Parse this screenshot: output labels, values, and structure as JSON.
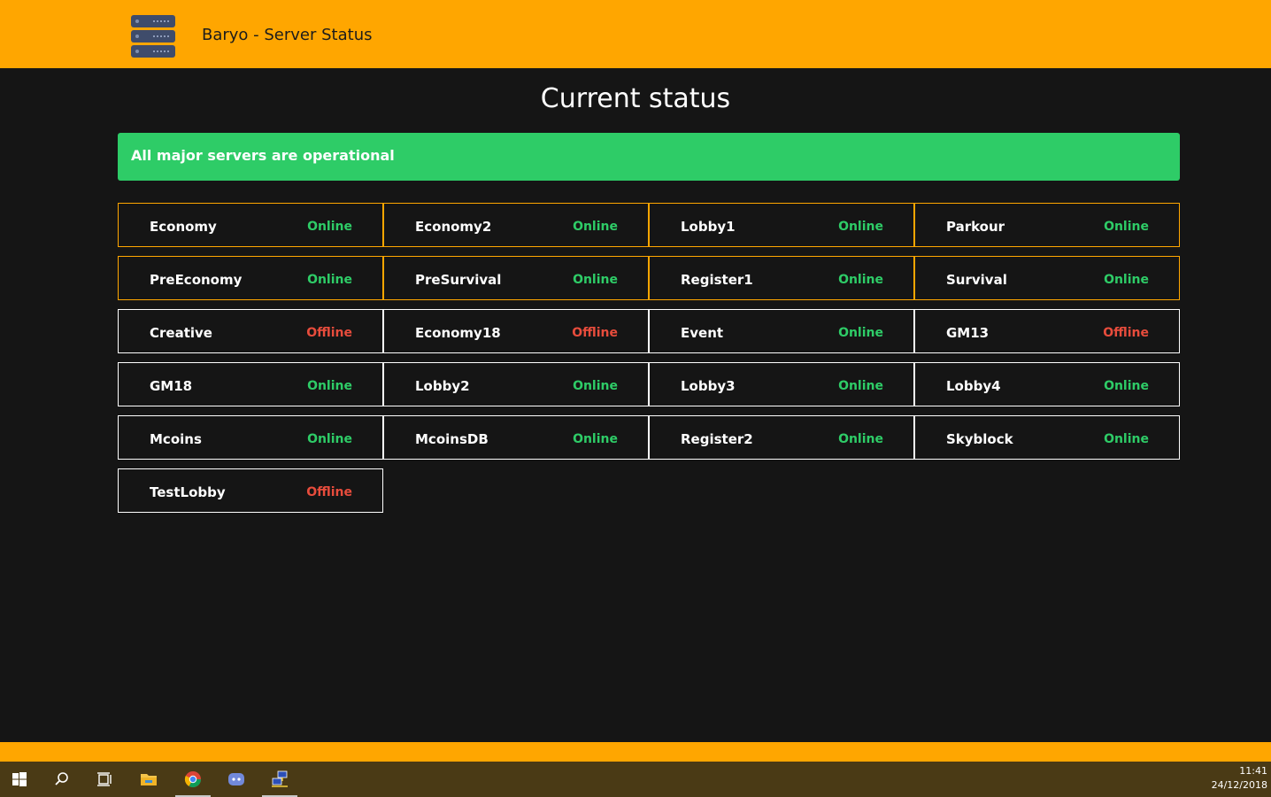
{
  "header": {
    "title": "Baryo - Server Status",
    "logo_icon": "server-rack-icon"
  },
  "page_title": "Current status",
  "alert": {
    "text": "All major servers are operational",
    "color": "#2ecc67"
  },
  "colors": {
    "accent": "#ffa600",
    "online": "#2ecc67",
    "offline": "#e74c3c",
    "background": "#151515"
  },
  "servers": [
    {
      "name": "Economy",
      "status": "Online"
    },
    {
      "name": "Economy2",
      "status": "Online"
    },
    {
      "name": "Lobby1",
      "status": "Online"
    },
    {
      "name": "Parkour",
      "status": "Online"
    },
    {
      "name": "PreEconomy",
      "status": "Online"
    },
    {
      "name": "PreSurvival",
      "status": "Online"
    },
    {
      "name": "Register1",
      "status": "Online"
    },
    {
      "name": "Survival",
      "status": "Online"
    },
    {
      "name": "Creative",
      "status": "Offline"
    },
    {
      "name": "Economy18",
      "status": "Offline"
    },
    {
      "name": "Event",
      "status": "Online"
    },
    {
      "name": "GM13",
      "status": "Offline"
    },
    {
      "name": "GM18",
      "status": "Online"
    },
    {
      "name": "Lobby2",
      "status": "Online"
    },
    {
      "name": "Lobby3",
      "status": "Online"
    },
    {
      "name": "Lobby4",
      "status": "Online"
    },
    {
      "name": "Mcoins",
      "status": "Online"
    },
    {
      "name": "McoinsDB",
      "status": "Online"
    },
    {
      "name": "Register2",
      "status": "Online"
    },
    {
      "name": "Skyblock",
      "status": "Online"
    },
    {
      "name": "TestLobby",
      "status": "Offline"
    }
  ],
  "taskbar": {
    "icons": [
      "windows-start-icon",
      "search-icon",
      "task-view-icon",
      "file-explorer-icon",
      "chrome-icon",
      "discord-icon",
      "network-app-icon"
    ],
    "time": "11:41",
    "date": "24/12/2018"
  }
}
